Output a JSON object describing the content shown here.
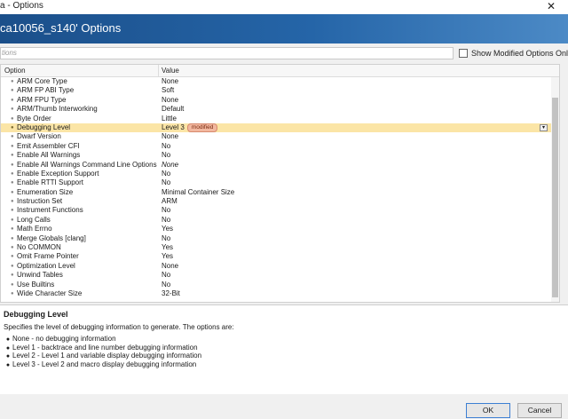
{
  "window": {
    "title": "a - Options",
    "close_glyph": "✕"
  },
  "header": {
    "title": "ca10056_s140' Options"
  },
  "filter": {
    "placeholder": "tions",
    "show_modified_label": "Show Modified Options Only"
  },
  "grid": {
    "columns": [
      "Option",
      "Value"
    ],
    "rows": [
      {
        "name": "ARM Core Type",
        "value": "None"
      },
      {
        "name": "ARM FP ABI Type",
        "value": "Soft"
      },
      {
        "name": "ARM FPU Type",
        "value": "None"
      },
      {
        "name": "ARM/Thumb Interworking",
        "value": "Default"
      },
      {
        "name": "Byte Order",
        "value": "Little"
      },
      {
        "name": "Debugging Level",
        "value": "Level 3",
        "badge": "modified",
        "selected": true
      },
      {
        "name": "Dwarf Version",
        "value": "None"
      },
      {
        "name": "Emit Assembler CFI",
        "value": "No"
      },
      {
        "name": "Enable All Warnings",
        "value": "No"
      },
      {
        "name": "Enable All Warnings Command Line Options",
        "value": "None",
        "italic": true
      },
      {
        "name": "Enable Exception Support",
        "value": "No"
      },
      {
        "name": "Enable RTTI Support",
        "value": "No"
      },
      {
        "name": "Enumeration Size",
        "value": "Minimal Container Size"
      },
      {
        "name": "Instruction Set",
        "value": "ARM"
      },
      {
        "name": "Instrument Functions",
        "value": "No"
      },
      {
        "name": "Long Calls",
        "value": "No"
      },
      {
        "name": "Math Errno",
        "value": "Yes"
      },
      {
        "name": "Merge Globals [clang]",
        "value": "No"
      },
      {
        "name": "No COMMON",
        "value": "Yes"
      },
      {
        "name": "Omit Frame Pointer",
        "value": "Yes"
      },
      {
        "name": "Optimization Level",
        "value": "None"
      },
      {
        "name": "Unwind Tables",
        "value": "No"
      },
      {
        "name": "Use Builtins",
        "value": "No"
      },
      {
        "name": "Wide Character Size",
        "value": "32-Bit"
      }
    ]
  },
  "description": {
    "heading": "Debugging Level",
    "text": "Specifies the level of debugging information to generate. The options are:",
    "items": [
      "None - no debugging information",
      "Level 1 - backtrace and line number debugging information",
      "Level 2 - Level 1 and variable display debugging information",
      "Level 3 - Level 2 and macro display debugging information"
    ]
  },
  "buttons": {
    "ok": "OK",
    "cancel": "Cancel"
  },
  "colors": {
    "header_start": "#1b4f8a",
    "header_end": "#4c8ac6",
    "selected_row": "#fbe5a6",
    "badge": "#f2b8a0"
  }
}
